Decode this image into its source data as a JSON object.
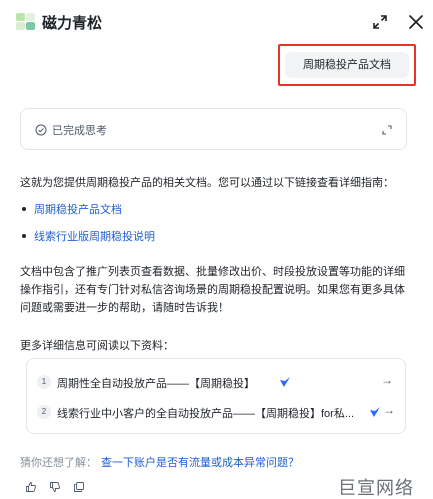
{
  "header": {
    "title": "磁力青松",
    "expand_icon": "expand-arrows-icon",
    "close_icon": "close-icon",
    "logo_colors": [
      "#b8e6a8",
      "#e3f2df",
      "#7dc9a6"
    ]
  },
  "user_message": {
    "text": "周期稳投产品文档",
    "highlight_color": "#e8322b"
  },
  "thinking": {
    "label": "已完成思考",
    "status_icon": "check-circle-icon",
    "toggle_icon": "expand-icon"
  },
  "answer": {
    "intro": "这就为您提供周期稳投产品的相关文档。您可以通过以下链接查看详细指南：",
    "links": [
      {
        "label": "周期稳投产品文档"
      },
      {
        "label": "线索行业版周期稳投说明"
      }
    ],
    "body": "文档中包含了推广列表页查看数据、批量修改出价、时段投放设置等功能的详细操作指引，还有专门针对私信咨询场景的周期稳投配置说明。如果您有更多具体问题或需要进一步的帮助，请随时告诉我！",
    "more_title": "更多详细信息可阅读以下资料："
  },
  "references": [
    {
      "num": "1",
      "title": "周期性全自动投放产品——【周期稳投】",
      "badge_icon": "verified-icon"
    },
    {
      "num": "2",
      "title": "线索行业中小客户的全自动投放产品——【周期稳投】for私...",
      "badge_icon": "verified-icon"
    }
  ],
  "suggestion": {
    "label": "猜你还想了解：",
    "link": "查一下账户是否有流量或成本异常问题？"
  },
  "feedback": {
    "icons": [
      "thumbs-up-icon",
      "thumbs-down-icon",
      "copy-icon"
    ]
  },
  "watermark": "巨宣网络",
  "colors": {
    "link": "#1f5fd0",
    "badge": "#2f6bff",
    "text": "#1f2329",
    "muted": "#86909c"
  }
}
